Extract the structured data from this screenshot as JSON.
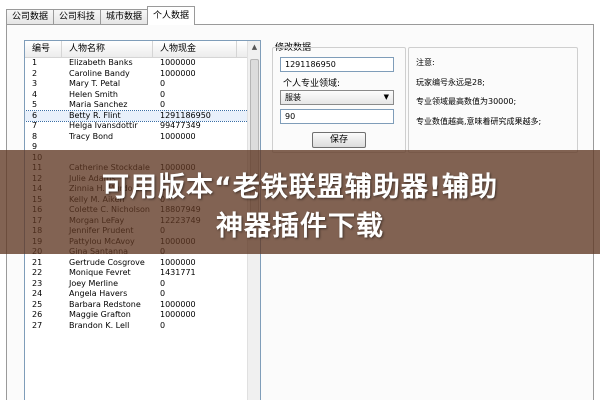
{
  "tabs": [
    {
      "label": "公司数据"
    },
    {
      "label": "公司科技"
    },
    {
      "label": "城市数据"
    },
    {
      "label": "个人数据"
    }
  ],
  "list": {
    "columns": [
      "编号",
      "人物名称",
      "人物现金"
    ],
    "rows": [
      {
        "id": "1",
        "name": "Elizabeth Banks",
        "cash": "1000000"
      },
      {
        "id": "2",
        "name": "Caroline Bandy",
        "cash": "1000000"
      },
      {
        "id": "3",
        "name": "Mary T. Petal",
        "cash": "0"
      },
      {
        "id": "4",
        "name": "Helen Smith",
        "cash": "0"
      },
      {
        "id": "5",
        "name": "Maria Sanchez",
        "cash": "0"
      },
      {
        "id": "6",
        "name": "Betty R. Flint",
        "cash": "1291186950"
      },
      {
        "id": "7",
        "name": "Helga Ivansdottir",
        "cash": "99477349"
      },
      {
        "id": "8",
        "name": "Tracy Bond",
        "cash": "1000000"
      },
      {
        "id": "9",
        "name": "",
        "cash": ""
      },
      {
        "id": "10",
        "name": "",
        "cash": ""
      },
      {
        "id": "11",
        "name": "Catherine Stockdale",
        "cash": "1000000"
      },
      {
        "id": "12",
        "name": "Julie Adams",
        "cash": "0"
      },
      {
        "id": "14",
        "name": "Zinnia H. Murdoch",
        "cash": "0"
      },
      {
        "id": "15",
        "name": "Kelly M. Aiken",
        "cash": "0"
      },
      {
        "id": "16",
        "name": "Colette C. Nicholson",
        "cash": "18807949"
      },
      {
        "id": "17",
        "name": "Morgan LeFay",
        "cash": "12223749"
      },
      {
        "id": "18",
        "name": "Jennifer Prudent",
        "cash": "0"
      },
      {
        "id": "19",
        "name": "Pattylou McAvoy",
        "cash": "1000000"
      },
      {
        "id": "20",
        "name": "Gina Santanna",
        "cash": "0"
      },
      {
        "id": "21",
        "name": "Gertrude Cosgrove",
        "cash": "1000000"
      },
      {
        "id": "22",
        "name": "Monique Fevret",
        "cash": "1431771"
      },
      {
        "id": "23",
        "name": "Joey Merline",
        "cash": "0"
      },
      {
        "id": "24",
        "name": "Angela Havers",
        "cash": "0"
      },
      {
        "id": "25",
        "name": "Barbara Redstone",
        "cash": "1000000"
      },
      {
        "id": "26",
        "name": "Maggie Grafton",
        "cash": "1000000"
      },
      {
        "id": "27",
        "name": "Brandon K. Lell",
        "cash": "0"
      }
    ],
    "selected_row": "6"
  },
  "modify": {
    "group_title": "修改数据",
    "cash_value": "1291186950",
    "field_label": "个人专业领域:",
    "field_value": "服装",
    "level_value": "90",
    "save_label": "保存"
  },
  "notes": {
    "title": "注意:",
    "lines": [
      "玩家编号永远是28;",
      "专业领域最高数值为30000;",
      "专业数值越高,意味着研究成果越多;"
    ]
  },
  "banner": {
    "line1": "可用版本“老铁联盟辅助器!辅助",
    "line2": "神器插件下载"
  }
}
